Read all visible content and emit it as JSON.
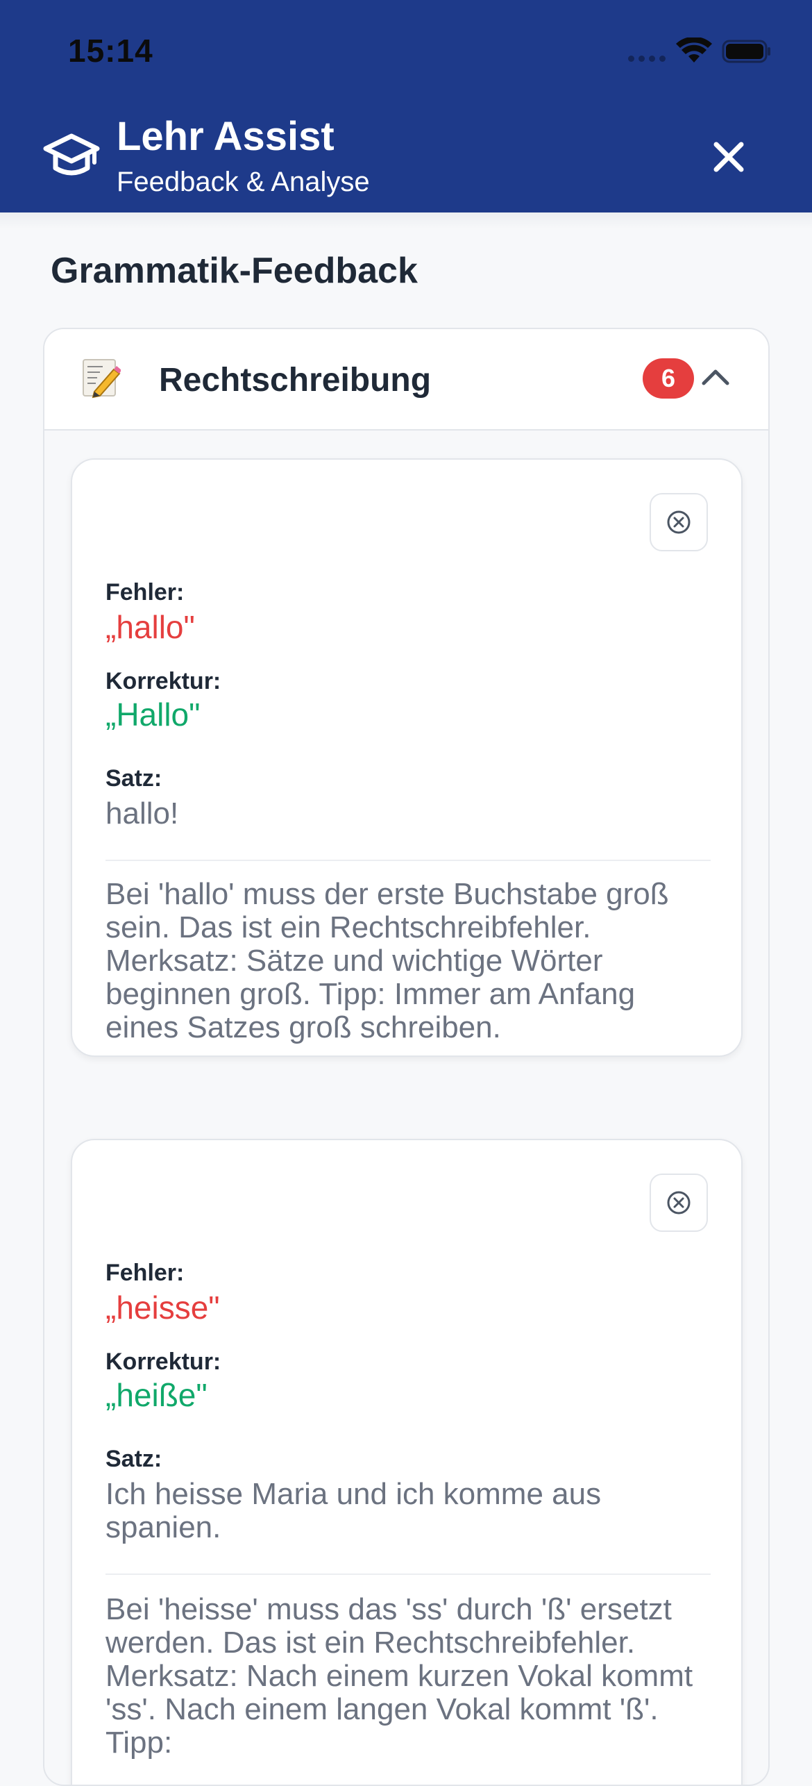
{
  "status_bar": {
    "time": "15:14"
  },
  "header": {
    "title": "Lehr Assist",
    "subtitle": "Feedback & Analyse",
    "brand_icon": "graduation-cap-icon",
    "close_icon": "close-icon"
  },
  "section": {
    "title": "Grammatik-Feedback"
  },
  "category": {
    "emoji": "memo-pencil-icon",
    "title": "Rechtschreibung",
    "count": "6",
    "expanded": true
  },
  "labels": {
    "error": "Fehler:",
    "correction": "Korrektur:",
    "sentence": "Satz:"
  },
  "cards": [
    {
      "error": "„hallo\"",
      "correction": "„Hallo\"",
      "sentence": "hallo!",
      "explanation": "Bei 'hallo' muss der erste Buchstabe groß sein. Das ist ein Rechtschreibfehler. Merksatz: Sätze und wichtige Wörter beginnen groß. Tipp: Immer am Anfang eines Satzes groß schreiben."
    },
    {
      "error": "„heisse\"",
      "correction": "„heiße\"",
      "sentence": "Ich heisse Maria und ich komme aus spanien.",
      "explanation": "Bei 'heisse' muss das 'ss' durch 'ß' ersetzt werden. Das ist ein Rechtschreibfehler. Merksatz: Nach einem kurzen Vokal kommt 'ss'. Nach einem langen Vokal kommt 'ß'. Tipp:"
    }
  ],
  "colors": {
    "header_bg": "#1e3a8a",
    "error": "#e53e3e",
    "correction": "#10a86a",
    "badge": "#e53e3e"
  }
}
